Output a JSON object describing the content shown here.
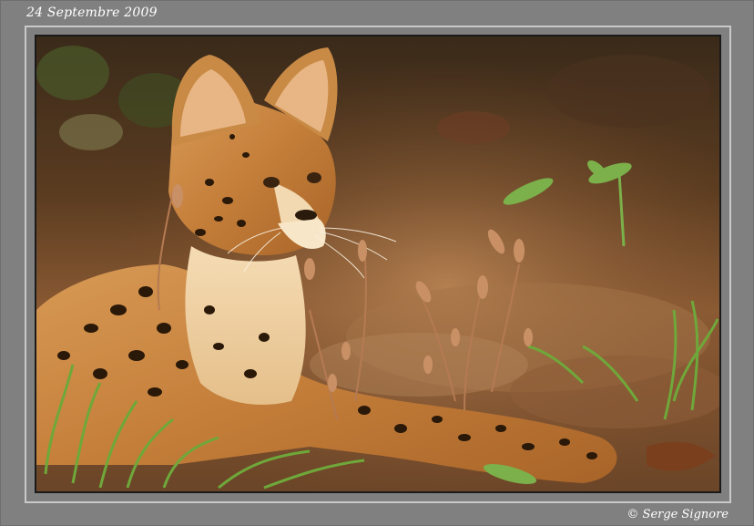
{
  "caption": {
    "date": "24 Septembre 2009",
    "credit": "© Serge Signore"
  },
  "photo": {
    "subject": "serval",
    "colors": {
      "frame": "#808080",
      "inner_line": "#c9c9c9",
      "photo_border": "#1a1a1a"
    }
  }
}
